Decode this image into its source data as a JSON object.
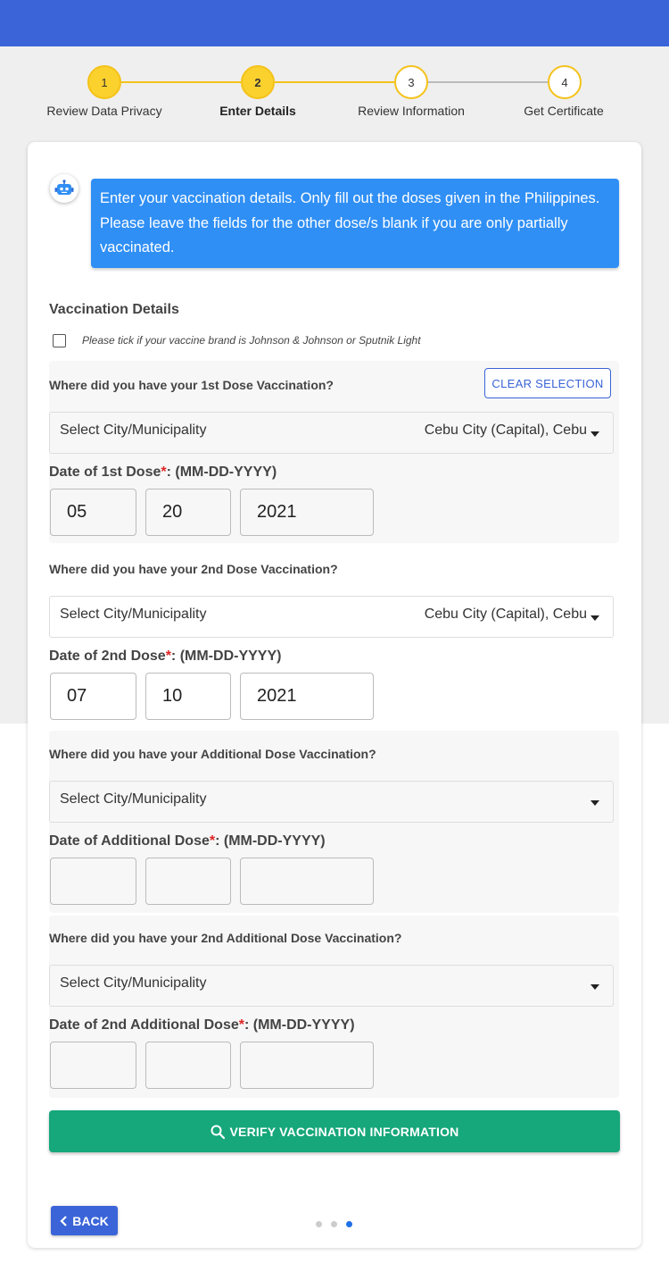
{
  "stepper": {
    "steps": [
      {
        "number": "1",
        "label": "Review Data Privacy",
        "state": "done"
      },
      {
        "number": "2",
        "label": "Enter Details",
        "state": "current"
      },
      {
        "number": "3",
        "label": "Review Information",
        "state": "pending"
      },
      {
        "number": "4",
        "label": "Get Certificate",
        "state": "pending"
      }
    ]
  },
  "bot": {
    "icon": "robot-icon",
    "message": "Enter your vaccination details. Only fill out the doses given in the Philippines. Please leave the fields for the other dose/s blank if you are only partially vaccinated."
  },
  "form": {
    "title": "Vaccination Details",
    "single_dose_checkbox": {
      "checked": false,
      "label": "Please tick if your vaccine brand is Johnson & Johnson or Sputnik Light"
    },
    "clear_selection_label": "CLEAR SELECTION",
    "doses": [
      {
        "question": "Where did you have your 1st Dose Vaccination?",
        "select_placeholder": "Select City/Municipality",
        "select_value": "Cebu City (Capital), Cebu",
        "date_label": "Date of 1st Dose",
        "date_required_mark": "*",
        "date_format": ": (MM-DD-YYYY)",
        "month": "05",
        "day": "20",
        "year": "2021"
      },
      {
        "question": "Where did you have your 2nd Dose Vaccination?",
        "select_placeholder": "Select City/Municipality",
        "select_value": "Cebu City (Capital), Cebu",
        "date_label": "Date of 2nd Dose",
        "date_required_mark": "*",
        "date_format": ": (MM-DD-YYYY)",
        "month": "07",
        "day": "10",
        "year": "2021"
      },
      {
        "question": "Where did you have your Additional Dose Vaccination?",
        "select_placeholder": "Select City/Municipality",
        "select_value": "",
        "date_label": "Date of Additional Dose",
        "date_required_mark": "*",
        "date_format": ": (MM-DD-YYYY)",
        "month": "",
        "day": "",
        "year": ""
      },
      {
        "question": "Where did you have your 2nd Additional Dose Vaccination?",
        "select_placeholder": "Select City/Municipality",
        "select_value": "",
        "date_label": "Date of 2nd Additional Dose",
        "date_required_mark": "*",
        "date_format": ": (MM-DD-YYYY)",
        "month": "",
        "day": "",
        "year": ""
      }
    ],
    "verify_button": {
      "icon": "search-icon",
      "label": "VERIFY VACCINATION INFORMATION"
    }
  },
  "footer": {
    "back_button": {
      "icon": "chevron-left-icon",
      "label": "BACK"
    },
    "pagination": {
      "total": 3,
      "current": 3
    }
  },
  "colors": {
    "header": "#3a64d8",
    "step_active": "#fbd12e",
    "bubble": "#2f8ff5",
    "verify": "#16a77a",
    "required": "#e02424"
  }
}
